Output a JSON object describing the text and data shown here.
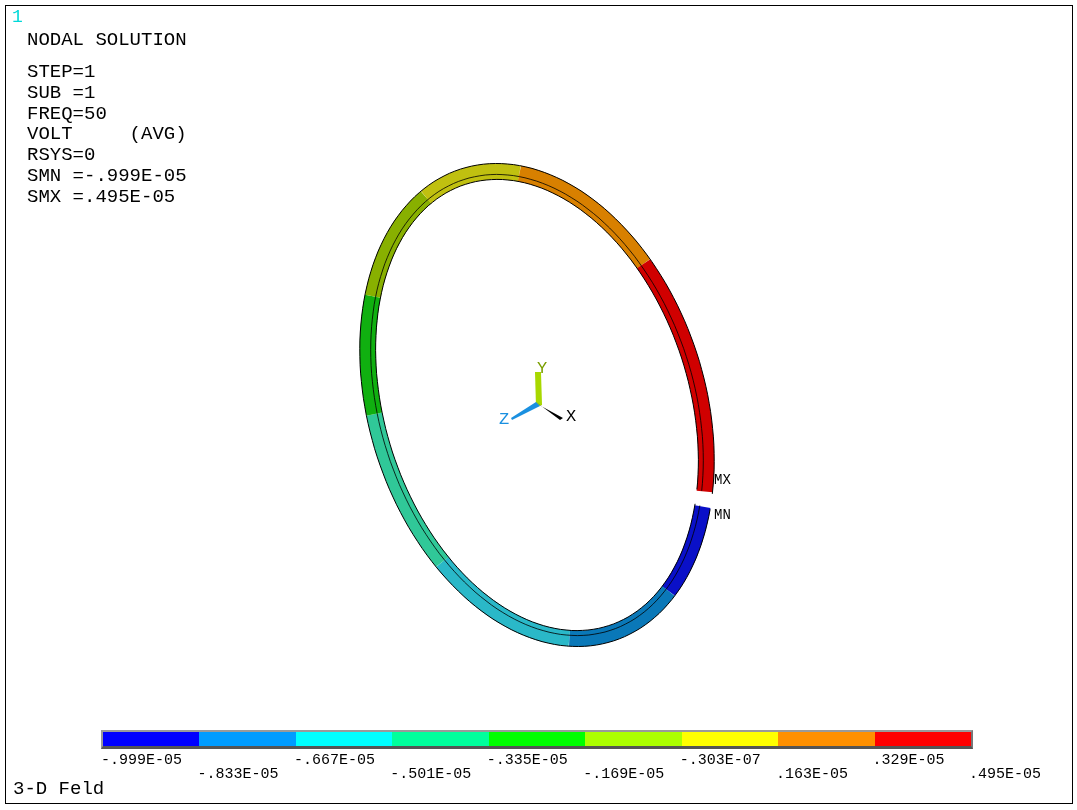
{
  "window_number": "1",
  "title": "NODAL SOLUTION",
  "info_lines": [
    "STEP=1",
    "SUB =1",
    "FREQ=50",
    "VOLT     (AVG)",
    "RSYS=0",
    "SMN =-.999E-05",
    "SMX =.495E-05"
  ],
  "triad": {
    "x_label": "X",
    "y_label": "Y",
    "z_label": "Z"
  },
  "markers": {
    "max_label": "MX",
    "min_label": "MN"
  },
  "legend": {
    "segments": [
      {
        "color": "#0000ff"
      },
      {
        "color": "#009cff"
      },
      {
        "color": "#00ffff"
      },
      {
        "color": "#00ff9c"
      },
      {
        "color": "#00ff00"
      },
      {
        "color": "#acff00"
      },
      {
        "color": "#ffff00"
      },
      {
        "color": "#ff9000"
      },
      {
        "color": "#ff0000"
      }
    ],
    "labels": [
      "-.999E-05",
      "-.833E-05",
      "-.667E-05",
      "-.501E-05",
      "-.335E-05",
      "-.169E-05",
      "-.303E-07",
      ".163E-05",
      ".329E-05",
      ".495E-05"
    ]
  },
  "footer_title": "3-D Feld"
}
